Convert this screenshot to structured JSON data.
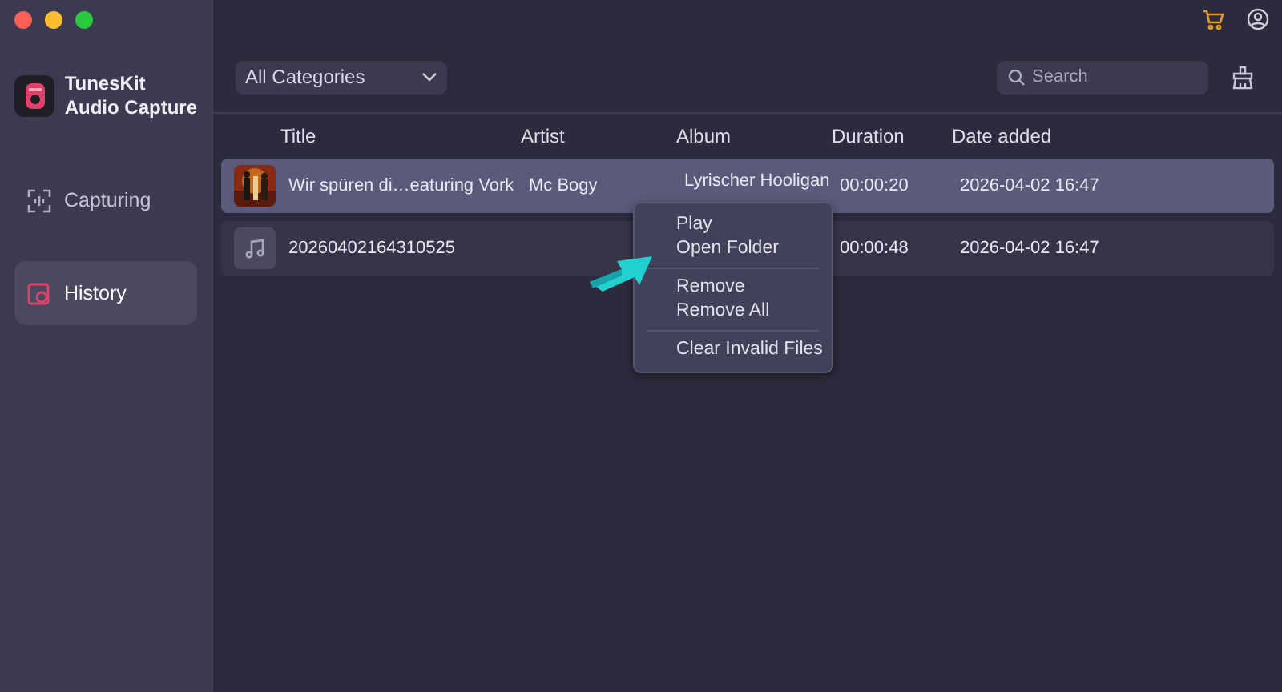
{
  "app": {
    "name": "TunesKit",
    "subtitle": "Audio Capture"
  },
  "sidebar": {
    "items": [
      {
        "label": "Capturing",
        "selected": false,
        "kind": "capture"
      },
      {
        "label": "History",
        "selected": true,
        "kind": "history"
      }
    ]
  },
  "toolbar": {
    "category": "All Categories",
    "search": {
      "placeholder": "Search"
    }
  },
  "table": {
    "columns": [
      "Title",
      "Artist",
      "Album",
      "Duration",
      "Date added"
    ],
    "rows": [
      {
        "title": "Wir spüren di…eaturing Vork",
        "artist": "Mc Bogy",
        "album": "Lyrischer Hooligan",
        "duration": "00:00:20",
        "date": "2026-04-02 16:47",
        "selected": true,
        "kind": "cover"
      },
      {
        "title": "20260402164310525",
        "artist": "",
        "album": "",
        "duration": "00:00:48",
        "date": "2026-04-02 16:47",
        "selected": false,
        "kind": "note"
      }
    ]
  },
  "context_menu": {
    "groups": [
      [
        "Play",
        "Open Folder"
      ],
      [
        "Remove",
        "Remove All"
      ],
      [
        "Clear Invalid Files"
      ]
    ]
  }
}
